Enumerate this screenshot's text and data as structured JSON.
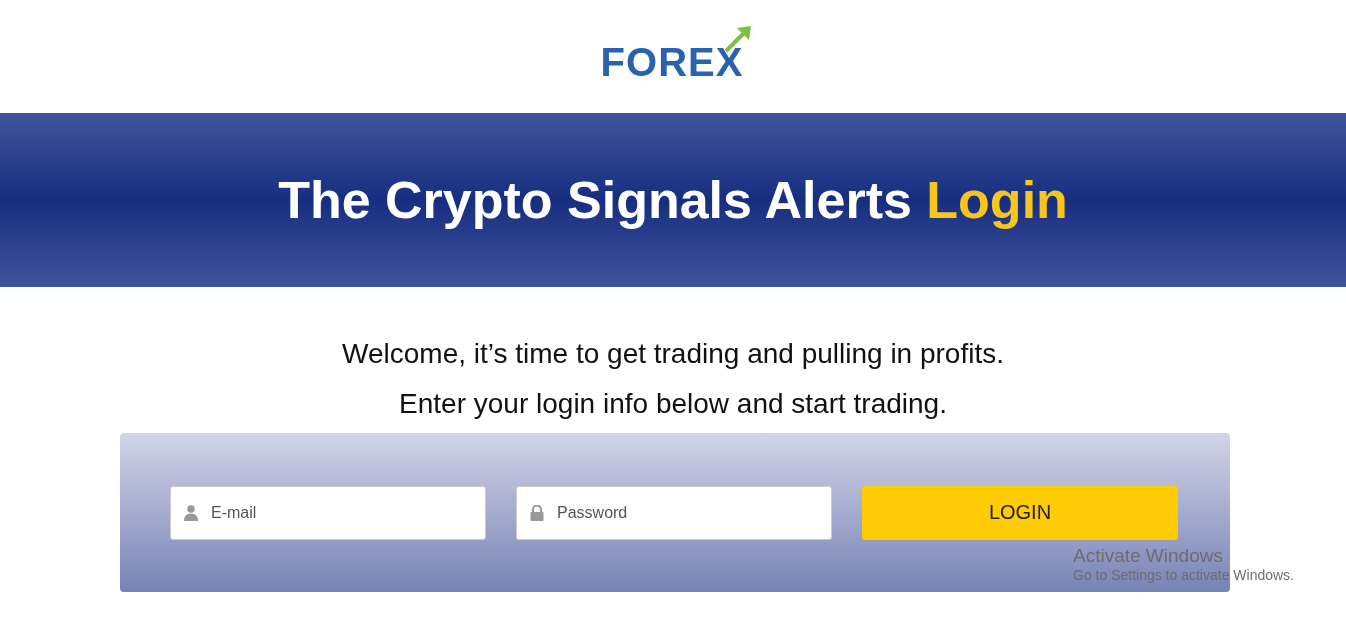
{
  "logo": {
    "text": "FOREX"
  },
  "banner": {
    "title": "The Crypto Signals Alerts",
    "highlight": "Login"
  },
  "intro": [
    "Welcome, it’s time to get trading and pulling in profits.",
    "Enter your login info below and start trading."
  ],
  "form": {
    "email": {
      "placeholder": "E-mail"
    },
    "password": {
      "placeholder": "Password"
    },
    "button": "LOGIN"
  },
  "os_notice": {
    "title": "Activate Windows",
    "text": "Go to Settings to activate Windows."
  }
}
